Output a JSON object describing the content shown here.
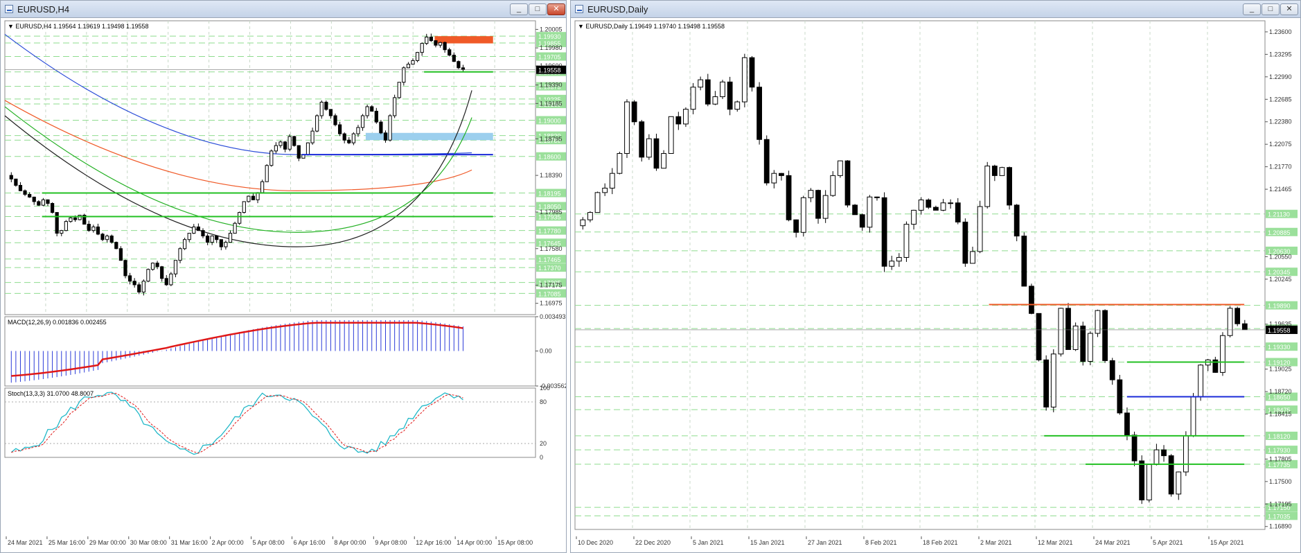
{
  "windows": {
    "left": {
      "title": "EURUSD,H4",
      "min_label": "_",
      "max_label": "□",
      "close_label": "✕"
    },
    "right": {
      "title": "EURUSD,Daily",
      "min_label": "_",
      "max_label": "□",
      "close_label": "✕"
    }
  },
  "chart_data": [
    {
      "type": "candlestick",
      "title": "EURUSD,H4",
      "ohlc_label": "EURUSD,H4  1.19564 1.19619 1.19498 1.19558",
      "last_price": "1.19558",
      "ylim": [
        1.1685,
        1.201
      ],
      "y_ticks": [
        "1.20005",
        "1.19980",
        "1.19600",
        "1.19390",
        "1.19185",
        "1.18795",
        "1.18390",
        "1.17985",
        "1.17580",
        "1.17175",
        "1.16975"
      ],
      "y_tick_values": [
        1.20005,
        1.198,
        1.196,
        1.1939,
        1.19185,
        1.18795,
        1.1839,
        1.17985,
        1.1758,
        1.17175,
        1.16975
      ],
      "level_labels": [
        "1.19930",
        "1.19855",
        "1.19705",
        "1.19535",
        "1.19375",
        "1.19235",
        "1.19180",
        "1.19000",
        "1.18830",
        "1.18780",
        "1.18600",
        "1.18195",
        "1.18050",
        "1.17935",
        "1.17780",
        "1.17645",
        "1.17465",
        "1.17370",
        "1.17205",
        "1.17085"
      ],
      "level_values": [
        1.1993,
        1.19855,
        1.19705,
        1.19535,
        1.19375,
        1.19235,
        1.1918,
        1.19,
        1.1883,
        1.1878,
        1.186,
        1.18195,
        1.1805,
        1.17935,
        1.1778,
        1.17645,
        1.17465,
        1.1737,
        1.17205,
        1.17085
      ],
      "x_labels": [
        "24 Mar 2021",
        "25 Mar 16:00",
        "29 Mar 00:00",
        "30 Mar 08:00",
        "31 Mar 16:00",
        "2 Apr 00:00",
        "5 Apr 08:00",
        "6 Apr 16:00",
        "8 Apr 00:00",
        "9 Apr 08:00",
        "12 Apr 16:00",
        "14 Apr 00:00",
        "15 Apr 08:00"
      ],
      "closes": [
        1.1835,
        1.1828,
        1.1822,
        1.1818,
        1.1815,
        1.181,
        1.1806,
        1.1812,
        1.1808,
        1.1798,
        1.1775,
        1.1778,
        1.1788,
        1.1792,
        1.179,
        1.1795,
        1.1785,
        1.1778,
        1.1782,
        1.1774,
        1.1768,
        1.1772,
        1.1765,
        1.1758,
        1.1745,
        1.1728,
        1.1722,
        1.1718,
        1.171,
        1.1722,
        1.1735,
        1.1742,
        1.1738,
        1.1725,
        1.1718,
        1.173,
        1.1745,
        1.1758,
        1.1768,
        1.1775,
        1.1782,
        1.1778,
        1.1772,
        1.1765,
        1.1772,
        1.1768,
        1.176,
        1.1765,
        1.1775,
        1.1786,
        1.1798,
        1.181,
        1.1816,
        1.1812,
        1.182,
        1.1832,
        1.185,
        1.1866,
        1.1872,
        1.1876,
        1.1868,
        1.1882,
        1.1872,
        1.1858,
        1.1862,
        1.1875,
        1.1888,
        1.1905,
        1.192,
        1.1912,
        1.1905,
        1.1895,
        1.1885,
        1.1878,
        1.1875,
        1.1885,
        1.1892,
        1.1905,
        1.1915,
        1.191,
        1.1898,
        1.1886,
        1.1878,
        1.1905,
        1.1925,
        1.1942,
        1.1958,
        1.1962,
        1.1966,
        1.1975,
        1.1985,
        1.1992,
        1.1988,
        1.1983,
        1.1986,
        1.1978,
        1.1972,
        1.1965,
        1.1958,
        1.1956
      ],
      "hlines": [
        {
          "y": 1.19535,
          "color": "#22c022",
          "x_start_frac": 0.79
        },
        {
          "y": 1.1862,
          "color": "#1a2ad8",
          "x_start_frac": 0.56
        },
        {
          "y": 1.18195,
          "color": "#22c022",
          "x_start_frac": 0.07
        },
        {
          "y": 1.17935,
          "color": "#22c022",
          "x_start_frac": 0.07
        }
      ],
      "zones": [
        {
          "y1": 1.1985,
          "y2": 1.1993,
          "color": "#f05a28",
          "x_start_frac": 0.81
        },
        {
          "y1": 1.1878,
          "y2": 1.1886,
          "color": "#9ccfee",
          "x_start_frac": 0.68
        }
      ],
      "ma_lines": [
        {
          "name": "blue",
          "color": "#2a4cd8",
          "start": 1.1995,
          "mid": 1.1862,
          "end": 1.1864
        },
        {
          "name": "orange",
          "color": "#f05a28",
          "start": 1.1922,
          "mid": 1.1822,
          "end": 1.1845
        },
        {
          "name": "green",
          "color": "#22b022",
          "start": 1.1915,
          "mid": 1.1776,
          "end": 1.1903
        },
        {
          "name": "black",
          "color": "#222222",
          "start": 1.1905,
          "mid": 1.176,
          "end": 1.1933
        }
      ],
      "macd": {
        "label": "MACD(12,26,9) 0.001836 0.002455",
        "ticks": [
          "0.003493",
          "0.00",
          "-0.003562"
        ],
        "ylim": [
          -0.003562,
          0.003493
        ]
      },
      "stoch": {
        "label": "Stoch(13,3,3) 31.0700 48.8007",
        "ticks": [
          "100",
          "80",
          "20",
          "0"
        ]
      }
    },
    {
      "type": "candlestick",
      "title": "EURUSD,Daily",
      "ohlc_label": "EURUSD,Daily  1.19649 1.19740 1.19498 1.19558",
      "last_price": "1.19558",
      "ylim": [
        1.1685,
        1.2375
      ],
      "y_ticks": [
        "1.23600",
        "1.23295",
        "1.22990",
        "1.22685",
        "1.22380",
        "1.22075",
        "1.21770",
        "1.21465",
        "1.20550",
        "1.20245",
        "1.19635",
        "1.19025",
        "1.18720",
        "1.18415",
        "1.17805",
        "1.17500",
        "1.17195",
        "1.16890"
      ],
      "y_tick_values": [
        1.236,
        1.23295,
        1.2299,
        1.22685,
        1.2238,
        1.22075,
        1.2177,
        1.21465,
        1.2055,
        1.20245,
        1.19635,
        1.19025,
        1.1872,
        1.18415,
        1.17805,
        1.175,
        1.17195,
        1.1689
      ],
      "level_labels": [
        "1.21130",
        "1.20885",
        "1.20630",
        "1.20345",
        "1.19890",
        "1.19575",
        "1.19330",
        "1.19120",
        "1.18650",
        "1.18475",
        "1.18120",
        "1.17930",
        "1.17735",
        "1.17150",
        "1.17035"
      ],
      "level_values": [
        1.2113,
        1.20885,
        1.2063,
        1.20345,
        1.1989,
        1.19575,
        1.1933,
        1.1912,
        1.1865,
        1.18475,
        1.1812,
        1.1793,
        1.17735,
        1.1715,
        1.17035
      ],
      "x_labels": [
        "10 Dec 2020",
        "22 Dec 2020",
        "5 Jan 2021",
        "15 Jan 2021",
        "27 Jan 2021",
        "8 Feb 2021",
        "18 Feb 2021",
        "2 Mar 2021",
        "12 Mar 2021",
        "24 Mar 2021",
        "5 Apr 2021",
        "15 Apr 2021"
      ],
      "closes": [
        1.2105,
        1.2115,
        1.2142,
        1.2148,
        1.2168,
        1.2195,
        1.2265,
        1.2238,
        1.219,
        1.2215,
        1.2175,
        1.2195,
        1.2245,
        1.2235,
        1.2255,
        1.2285,
        1.2295,
        1.2262,
        1.2272,
        1.2292,
        1.2255,
        1.2265,
        1.2325,
        1.2285,
        1.2214,
        1.2155,
        1.2168,
        1.2165,
        1.2105,
        1.2088,
        1.2135,
        1.2145,
        1.2107,
        1.2138,
        1.2165,
        1.2185,
        1.2125,
        1.2112,
        1.2095,
        1.2136,
        1.2135,
        1.2042,
        1.2049,
        1.2054,
        1.2099,
        1.2118,
        1.2132,
        1.2122,
        1.2118,
        1.2128,
        1.2128,
        1.2102,
        1.2046,
        1.2062,
        1.2123,
        1.2178,
        1.2165,
        1.2176,
        1.2125,
        1.2083,
        1.2015,
        1.1978,
        1.1915,
        1.1851,
        1.1923,
        1.1985,
        1.1929,
        1.1961,
        1.1913,
        1.1951,
        1.1982,
        1.1914,
        1.1888,
        1.1843,
        1.1813,
        1.1778,
        1.1725,
        1.1773,
        1.1793,
        1.1785,
        1.1733,
        1.1763,
        1.1812,
        1.1865,
        1.1908,
        1.1915,
        1.1898,
        1.1948,
        1.1985,
        1.1964,
        1.1956
      ],
      "hlines": [
        {
          "y": 1.199,
          "color": "#f05a28",
          "x_start_frac": 0.6
        },
        {
          "y": 1.1912,
          "color": "#22c022",
          "x_start_frac": 0.8
        },
        {
          "y": 1.1865,
          "color": "#1a2ad8",
          "x_start_frac": 0.8
        },
        {
          "y": 1.1812,
          "color": "#22c022",
          "x_start_frac": 0.68
        },
        {
          "y": 1.17735,
          "color": "#22c022",
          "x_start_frac": 0.74
        }
      ],
      "zones": [],
      "ma_lines": []
    }
  ]
}
